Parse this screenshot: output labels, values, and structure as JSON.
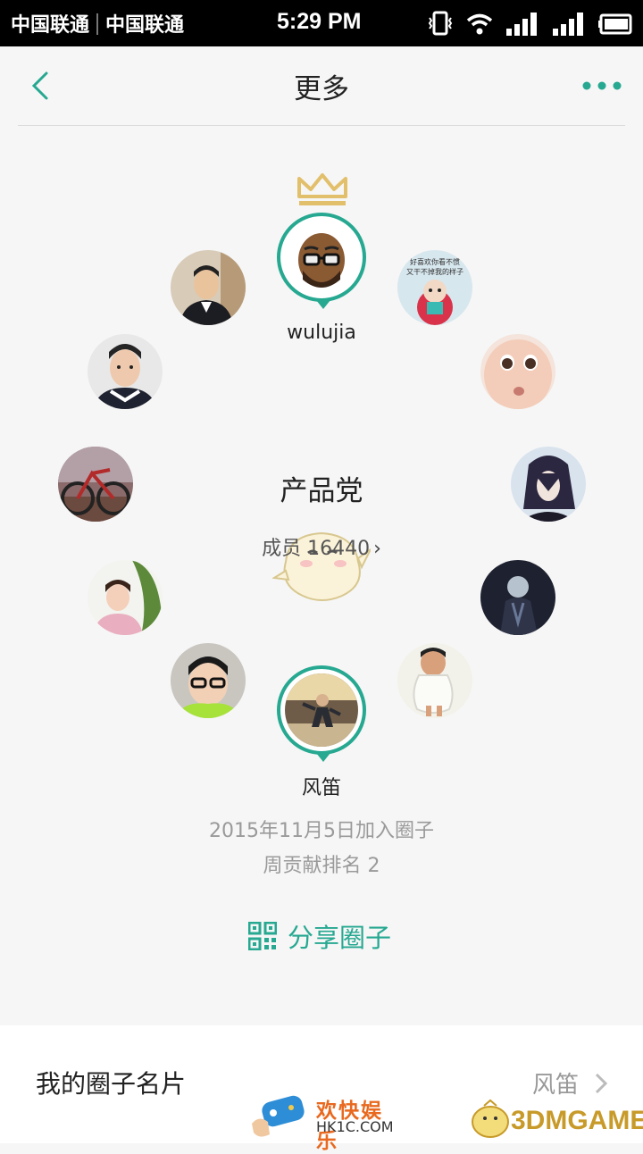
{
  "status_bar": {
    "carrier1": "中国联通",
    "carrier2": "中国联通",
    "time": "5:29 PM"
  },
  "nav": {
    "title": "更多",
    "back_icon": "chevron-left-icon",
    "more_icon": "more-dots-icon"
  },
  "circle": {
    "owner_name": "wulujia",
    "group_name": "产品党",
    "members_label": "成员 16440",
    "member_avatars": [
      "avatar-1",
      "avatar-2",
      "avatar-3",
      "avatar-4",
      "avatar-5",
      "avatar-6",
      "avatar-7",
      "avatar-8",
      "avatar-9",
      "avatar-10",
      "avatar-11",
      "avatar-12"
    ],
    "avatar_snippet_text": "好喜欢你看不惯 又干不掉我的样子"
  },
  "me": {
    "name": "风笛",
    "join_date": "2015年11月5日加入圈子",
    "weekly_rank": "周贡献排名 2"
  },
  "share": {
    "label": "分享圈子",
    "icon": "qr-code-icon"
  },
  "card": {
    "label": "我的圈子名片",
    "value": "风笛"
  },
  "watermarks": {
    "left_text": "欢快娱乐",
    "left_url": "HK1C.COM",
    "right_text": "3DMGAME"
  },
  "colors": {
    "accent": "#26a891",
    "crown": "#e2bf6b"
  }
}
